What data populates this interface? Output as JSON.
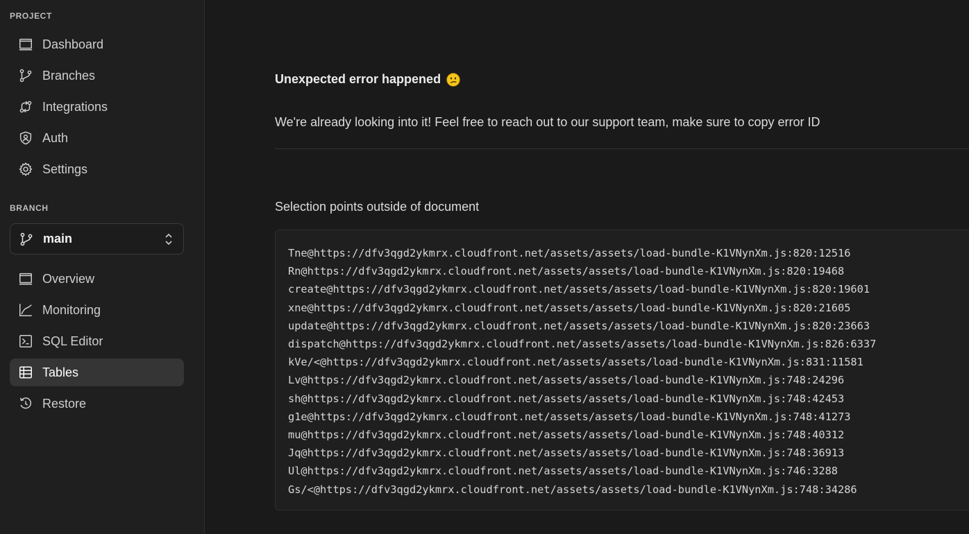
{
  "sidebar": {
    "project_label": "PROJECT",
    "project_items": [
      {
        "label": "Dashboard",
        "icon": "dashboard-icon"
      },
      {
        "label": "Branches",
        "icon": "branches-icon"
      },
      {
        "label": "Integrations",
        "icon": "integrations-icon"
      },
      {
        "label": "Auth",
        "icon": "auth-shield-icon"
      },
      {
        "label": "Settings",
        "icon": "gear-icon"
      }
    ],
    "branch_label": "BRANCH",
    "branch_select": {
      "value": "main",
      "icon": "branch-icon"
    },
    "branch_items": [
      {
        "label": "Overview",
        "icon": "overview-icon"
      },
      {
        "label": "Monitoring",
        "icon": "monitoring-icon"
      },
      {
        "label": "SQL Editor",
        "icon": "sql-editor-icon"
      },
      {
        "label": "Tables",
        "icon": "tables-icon",
        "active": true
      },
      {
        "label": "Restore",
        "icon": "restore-icon"
      }
    ]
  },
  "main": {
    "error_title": "Unexpected error happened",
    "error_emoji": "confused-face-emoji",
    "error_description": "We're already looking into it! Feel free to reach out to our support team, make sure to copy error ID",
    "error_message": "Selection points outside of document",
    "stack_trace": [
      "Tne@https://dfv3qgd2ykmrx.cloudfront.net/assets/assets/load-bundle-K1VNynXm.js:820:12516",
      "Rn@https://dfv3qgd2ykmrx.cloudfront.net/assets/assets/load-bundle-K1VNynXm.js:820:19468",
      "create@https://dfv3qgd2ykmrx.cloudfront.net/assets/assets/load-bundle-K1VNynXm.js:820:19601",
      "xne@https://dfv3qgd2ykmrx.cloudfront.net/assets/assets/load-bundle-K1VNynXm.js:820:21605",
      "update@https://dfv3qgd2ykmrx.cloudfront.net/assets/assets/load-bundle-K1VNynXm.js:820:23663",
      "dispatch@https://dfv3qgd2ykmrx.cloudfront.net/assets/assets/load-bundle-K1VNynXm.js:826:6337",
      "kVe/<@https://dfv3qgd2ykmrx.cloudfront.net/assets/assets/load-bundle-K1VNynXm.js:831:11581",
      "Lv@https://dfv3qgd2ykmrx.cloudfront.net/assets/assets/load-bundle-K1VNynXm.js:748:24296",
      "sh@https://dfv3qgd2ykmrx.cloudfront.net/assets/assets/load-bundle-K1VNynXm.js:748:42453",
      "g1e@https://dfv3qgd2ykmrx.cloudfront.net/assets/assets/load-bundle-K1VNynXm.js:748:41273",
      "mu@https://dfv3qgd2ykmrx.cloudfront.net/assets/assets/load-bundle-K1VNynXm.js:748:40312",
      "Jq@https://dfv3qgd2ykmrx.cloudfront.net/assets/assets/load-bundle-K1VNynXm.js:748:36913",
      "Ul@https://dfv3qgd2ykmrx.cloudfront.net/assets/assets/load-bundle-K1VNynXm.js:746:3288",
      "Gs/<@https://dfv3qgd2ykmrx.cloudfront.net/assets/assets/load-bundle-K1VNynXm.js:748:34286"
    ]
  }
}
